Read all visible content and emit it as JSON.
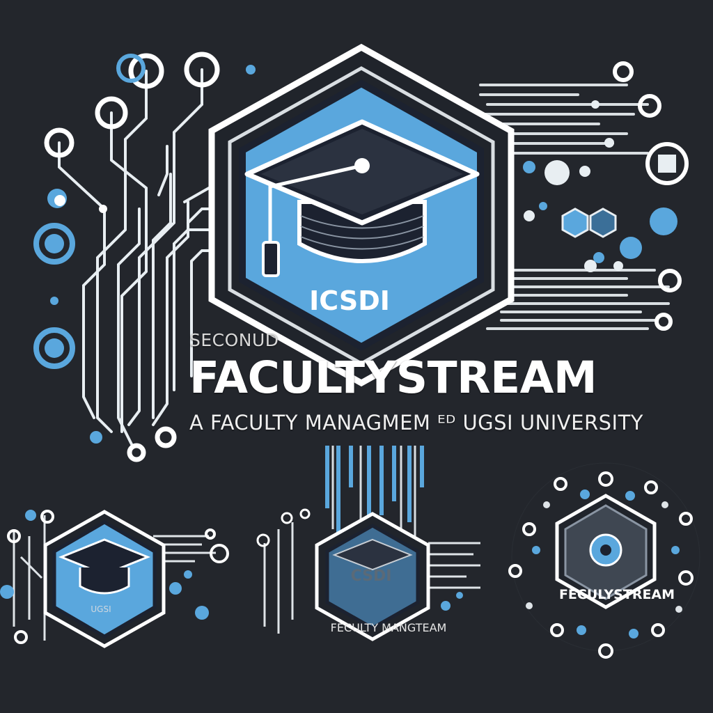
{
  "logo": {
    "kicker": "SECONUD",
    "title": "FACULTYSTREAM",
    "tagline": "A FACULTY MANAGMEM ᴱᴰ UGSI UNIVERSITY",
    "emblem_text": "ICSDI"
  },
  "variants": [
    {
      "label": "UGSI"
    },
    {
      "label": "CSDI",
      "caption": "FECULTY MANGTEAM"
    },
    {
      "label": "FECULYSTREAM"
    }
  ],
  "colors": {
    "background": "#23262c",
    "accent_blue": "#5aa7dd",
    "outline": "#ffffff",
    "dark_navy": "#1c2230"
  },
  "icons": [
    "graduation-cap-icon",
    "circuit-trace-icon",
    "hexagon-emblem-icon"
  ]
}
